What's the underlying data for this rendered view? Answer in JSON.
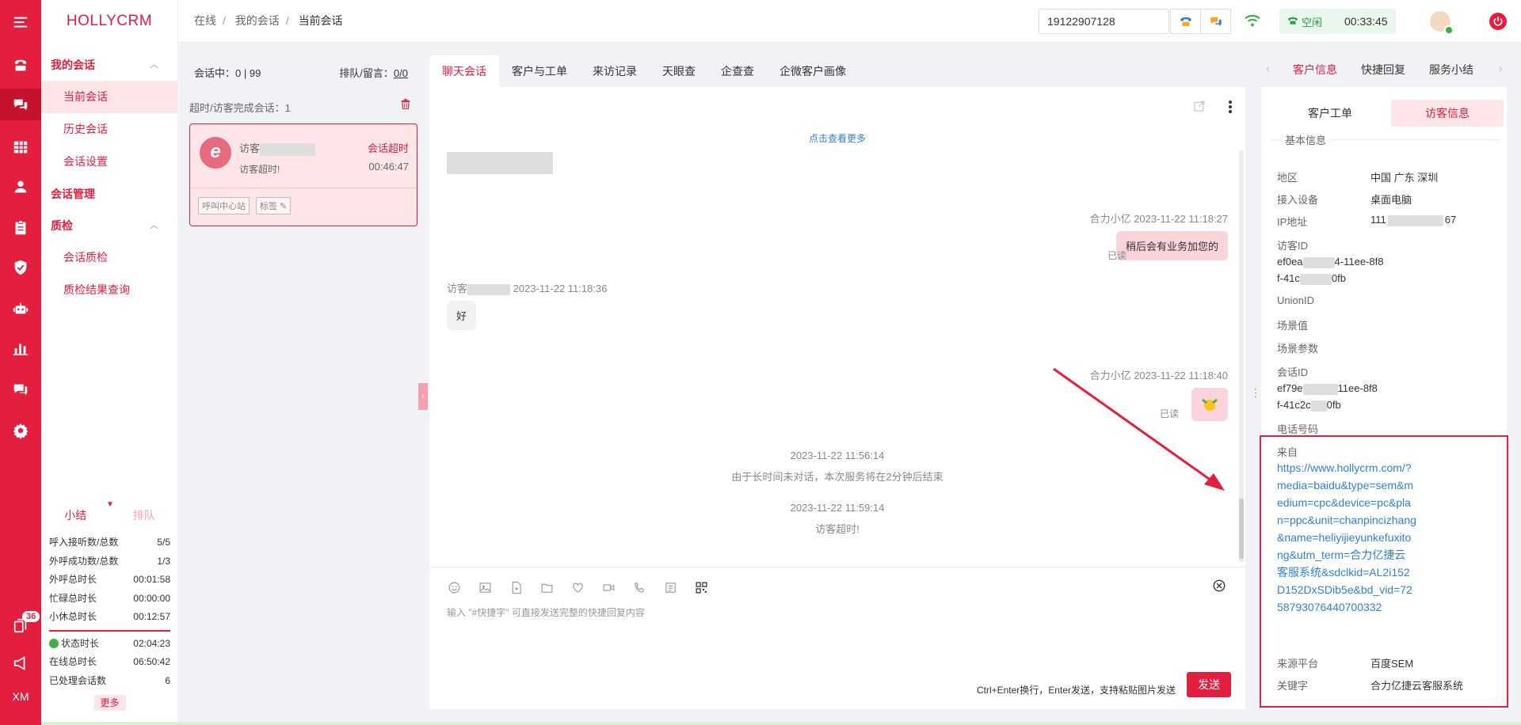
{
  "app": {
    "brand": "HOLLYCRM",
    "rail_badge": "36",
    "rail_footer": "XM"
  },
  "rail_icons": [
    "menu-icon",
    "phone-icon",
    "chat-icon",
    "grid-icon",
    "user-icon",
    "clipboard-icon",
    "shield-icon",
    "robot-icon",
    "chart-icon",
    "feedback-icon",
    "gear-icon",
    "copy-icon",
    "megaphone-icon"
  ],
  "nav": {
    "group1": "我的会话",
    "items1": [
      "当前会话",
      "历史会话",
      "会话设置"
    ],
    "group2": "会话管理",
    "group3": "质检",
    "items3": [
      "会话质检",
      "质检结果查询"
    ]
  },
  "stats": {
    "tab1": "小结",
    "tab2": "排队",
    "rows": [
      {
        "label": "呼入接听数/总数",
        "value": "5/5"
      },
      {
        "label": "外呼成功数/总数",
        "value": "1/3"
      },
      {
        "label": "外呼总时长",
        "value": "00:01:58"
      },
      {
        "label": "忙碌总时长",
        "value": "00:00:00"
      },
      {
        "label": "小休总时长",
        "value": "00:12:57"
      }
    ],
    "rows2": [
      {
        "label": "状态时长",
        "value": "02:04:23"
      },
      {
        "label": "在线总时长",
        "value": "06:50:42"
      },
      {
        "label": "已处理会话数",
        "value": "6"
      }
    ],
    "more": "更多"
  },
  "header": {
    "breadcrumb": [
      "在线",
      "我的会话",
      "当前会话"
    ],
    "phone": "19122907128",
    "status": "空闲",
    "timer": "00:33:45"
  },
  "sessions": {
    "in_session_label": "会话中：",
    "in_session": "0 | 99",
    "queue_label": "排队/留言：",
    "queue": "0/0",
    "timeout_label": "超时/访客完成会话：1",
    "card": {
      "name": "访客",
      "status": "会话超时",
      "message": "访客超时!",
      "time": "00:46:47",
      "tag1": "呼叫中心站",
      "tag2": "标签"
    }
  },
  "chat": {
    "tabs": [
      "聊天会话",
      "客户与工单",
      "来访记录",
      "天眼查",
      "企查查",
      "企微客户画像"
    ],
    "load_more": "点击查看更多",
    "msg1_meta": "合力小亿 2023-11-22 11:18:27",
    "msg1_text": "稍后会有业务加您的",
    "read": "已读",
    "msg2_name": "访客",
    "msg2_time": "2023-11-22 11:18:36",
    "msg2_text": "好",
    "msg3_meta": "合力小亿 2023-11-22 11:18:40",
    "sys1_time": "2023-11-22 11:56:14",
    "sys1_text": "由于长时间未对话，本次服务将在2分钟后结束",
    "sys2_time": "2023-11-22 11:59:14",
    "sys2_text": "访客超时!",
    "input_placeholder": "输入 \"#快捷字\" 可直接发送完整的快捷回复内容",
    "hint": "Ctrl+Enter换行，Enter发送，支持粘贴图片发送",
    "send": "发送",
    "toolbar_icons": [
      "emoji-icon",
      "image-icon",
      "video-icon",
      "folder-icon",
      "heart-icon",
      "camera-icon",
      "phone-call-icon",
      "list-icon",
      "qrcode-icon"
    ]
  },
  "right": {
    "tabs": [
      "客户信息",
      "快捷回复",
      "服务小结"
    ],
    "subtabs": [
      "客户工单",
      "访客信息"
    ],
    "section": "基本信息",
    "region_label": "地区",
    "region": "中国 广东 深圳",
    "device_label": "接入设备",
    "device": "桌面电脑",
    "ip_label": "IP地址",
    "ip_a": "111",
    "ip_b": "67",
    "visitor_id_label": "访客ID",
    "visitor_id_1a": "ef0ea",
    "visitor_id_1b": "4-11ee-8f8",
    "visitor_id_2a": "f-41c",
    "visitor_id_2b": "0fb",
    "unionid_label": "UnionID",
    "scene_label": "场景值",
    "scene_param_label": "场景参数",
    "session_id_label": "会话ID",
    "session_id_1a": "ef79e",
    "session_id_1b": "11ee-8f8",
    "session_id_2a": "f-41c2c",
    "session_id_2b": "0fb",
    "phone_label": "电话号码",
    "source_label": "来自",
    "source_url": "https://www.hollycrm.com/?media=baidu&type=sem&medium=cpc&device=pc&plan=ppc&unit=chanpincizhang&name=heliyijieyunkefuxitong&utm_term=合力亿捷云客服系统&sdclkid=AL2i152D152DxSDib5e&bd_vid=7258793076440700332",
    "platform_label": "来源平台",
    "platform": "百度SEM",
    "keyword_label": "关键字",
    "keyword": "合力亿捷云客服系统"
  },
  "colors": {
    "brand_red": "#e41e3f",
    "link_blue": "#2f7fd6",
    "idle_green": "#2e9b3e"
  }
}
